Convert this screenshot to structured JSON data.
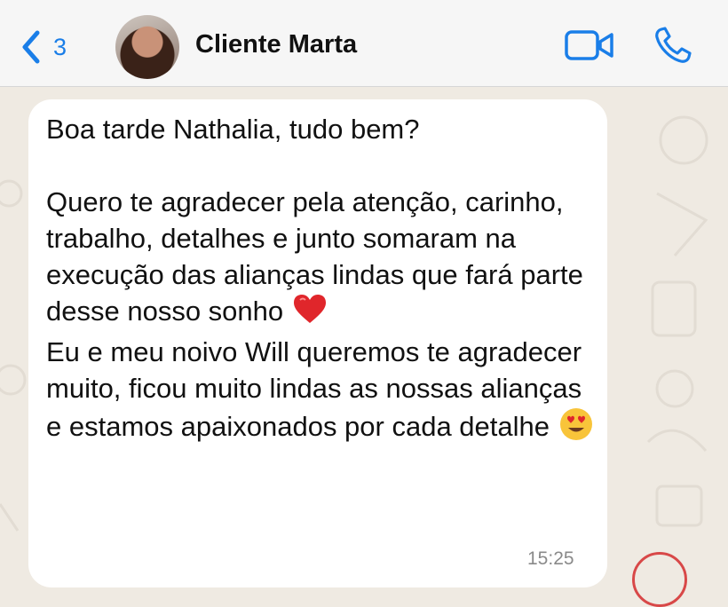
{
  "header": {
    "back_count": "3",
    "contact_name": "Cliente Marta"
  },
  "message": {
    "line1": "Boa tarde Nathalia, tudo bem?",
    "para1": "Quero te agradecer pela atenção, carinho, trabalho, detalhes e junto somaram na execução das alianças lindas que fará parte desse nosso sonho",
    "para2": "Eu e meu noivo Will queremos te agradecer muito, ficou muito lindas as nossas alianças e estamos apaixonados por cada detalhe",
    "emoji_heart": "red-heart",
    "emoji_love": "heart-eyes-face",
    "time": "15:25"
  },
  "colors": {
    "accent": "#1a7ee8",
    "bubble": "#ffffff",
    "wallpaper": "#efeae2"
  }
}
